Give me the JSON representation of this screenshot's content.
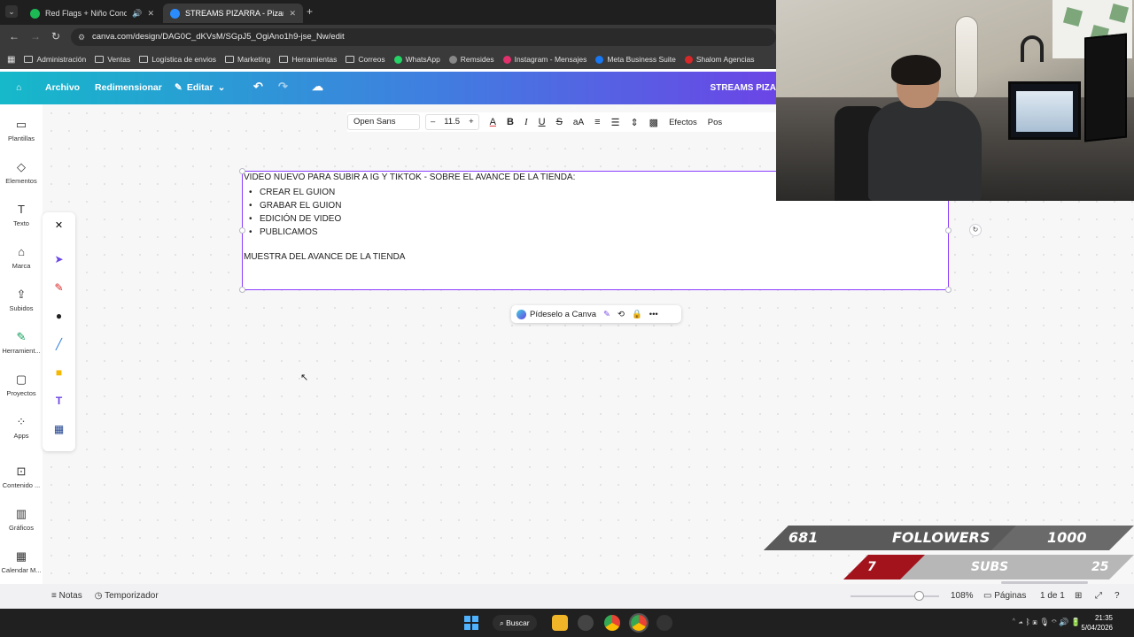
{
  "browser": {
    "tabs": [
      {
        "title": "Red Flags + Niño Condor",
        "favicon_color": "#1db954",
        "active": false
      },
      {
        "title": "STREAMS PIZARRA - Pizarra on...",
        "favicon_color": "#2b8cff",
        "active": true
      }
    ],
    "url": "canva.com/design/DAG0C_dKVsM/SGpJ5_OgiAno1h9-jse_Nw/edit",
    "bookmarks": [
      "Administración",
      "Ventas",
      "Logística de envios",
      "Marketing",
      "Herramientas",
      "Correos",
      "WhatsApp",
      "Remsides",
      "Instagram - Mensajes",
      "Meta Business Suite",
      "Shalom Agencias"
    ]
  },
  "canva_header": {
    "archivo": "Archivo",
    "redimensionar": "Redimensionar",
    "editar": "Editar",
    "title": "STREAMS PIZA"
  },
  "sidebar": {
    "items": [
      {
        "label": "Plantillas",
        "icon": "templates-icon"
      },
      {
        "label": "Elementos",
        "icon": "elements-icon"
      },
      {
        "label": "Texto",
        "icon": "text-icon"
      },
      {
        "label": "Marca",
        "icon": "brand-icon"
      },
      {
        "label": "Subidos",
        "icon": "upload-icon"
      },
      {
        "label": "Herramient...",
        "icon": "tools-icon"
      },
      {
        "label": "Proyectos",
        "icon": "folder-icon"
      },
      {
        "label": "Apps",
        "icon": "apps-icon"
      },
      {
        "label": "Contenido ...",
        "icon": "content-icon"
      },
      {
        "label": "Gráficos",
        "icon": "charts-icon"
      },
      {
        "label": "Calendar M...",
        "icon": "calendar-icon"
      }
    ]
  },
  "text_toolbar": {
    "font": "Open Sans",
    "size": "11.5",
    "effects": "Efectos",
    "position": "Pos"
  },
  "textbox": {
    "heading": "VIDEO NUEVO PARA SUBIR A IG Y TIKTOK - SOBRE EL AVANCE DE LA TIENDA:",
    "items": [
      "CREAR EL GUION",
      "GRABAR EL GUION",
      "EDICIÓN DE VIDEO",
      "PUBLICAMOS"
    ],
    "footer": "MUESTRA DEL AVANCE DE LA TIENDA"
  },
  "context_toolbar": {
    "ask": "Pídeselo a Canva"
  },
  "bottom_bar": {
    "notes": "Notas",
    "timer": "Temporizador",
    "zoom": "108%",
    "pages_label": "Páginas",
    "pages_value": "1 de 1"
  },
  "taskbar": {
    "search": "Buscar",
    "time": "21:35",
    "date": "5/04/2026"
  },
  "stream_overlay": {
    "followers_current": "681",
    "followers_label": "FOLLOWERS",
    "followers_goal": "1000",
    "followers_progress": 0.681,
    "subs_current": "7",
    "subs_label": "SUBS",
    "subs_goal": "25",
    "subs_progress": 0.28
  }
}
